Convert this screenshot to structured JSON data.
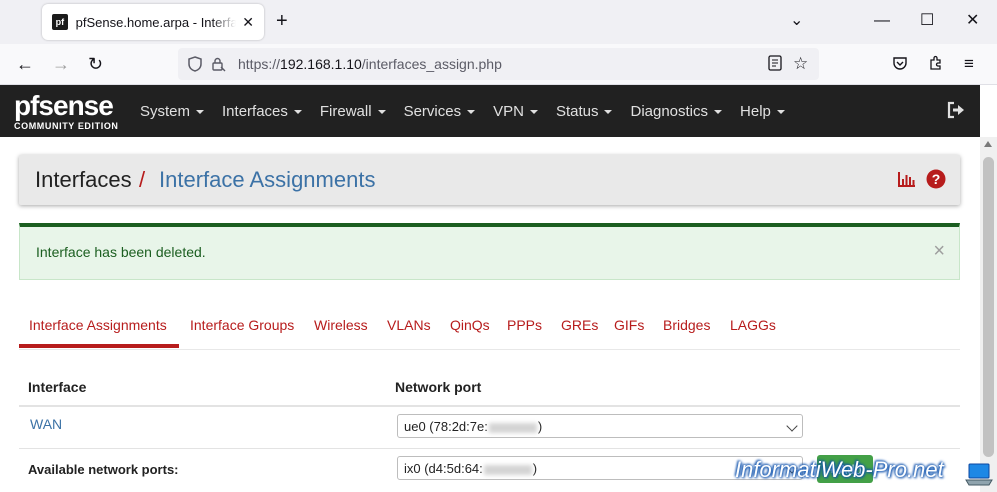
{
  "browser": {
    "tab_title": "pfSense.home.arpa - Interfaces: Interface Assignments",
    "favicon_text": "pf",
    "url_prefix": "https://",
    "url_host": "192.168.1.10",
    "url_path": "/interfaces_assign.php"
  },
  "pfnav": {
    "logo_main": "pfsense",
    "logo_sub": "COMMUNITY EDITION",
    "menu": [
      "System",
      "Interfaces",
      "Firewall",
      "Services",
      "VPN",
      "Status",
      "Diagnostics",
      "Help"
    ]
  },
  "breadcrumb": {
    "first": "Interfaces",
    "separator": "/",
    "last": "Interface Assignments"
  },
  "alert": {
    "message": "Interface has been deleted.",
    "close": "×"
  },
  "tabs": [
    "Interface Assignments",
    "Interface Groups",
    "Wireless",
    "VLANs",
    "QinQs",
    "PPPs",
    "GREs",
    "GIFs",
    "Bridges",
    "LAGGs"
  ],
  "table": {
    "headers": {
      "interface": "Interface",
      "network_port": "Network port"
    },
    "rows": [
      {
        "interface": "WAN",
        "port_prefix": "ue0 (78:2d:7e:",
        "port_suffix": ")"
      },
      {
        "interface": "Available network ports:",
        "port_prefix": "ix0 (d4:5d:64:",
        "port_suffix": ")"
      }
    ],
    "add_button": "+ Add"
  },
  "watermark": "InformatiWeb-Pro.net",
  "colors": {
    "pf_nav_bg": "#212121",
    "link_blue": "#3c72a6",
    "tab_red": "#b71c1c",
    "success_green": "#1b5e20",
    "success_bg": "#e8f5e9"
  }
}
